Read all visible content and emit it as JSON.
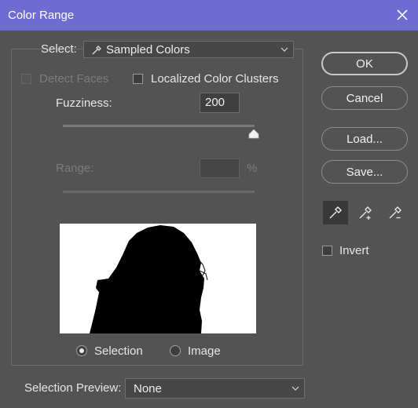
{
  "window": {
    "title": "Color Range"
  },
  "select": {
    "label": "Select:",
    "value": "Sampled Colors"
  },
  "detect_faces": {
    "label": "Detect Faces",
    "checked": false,
    "enabled": false
  },
  "localized_clusters": {
    "label": "Localized Color Clusters",
    "checked": false
  },
  "fuzziness": {
    "label": "Fuzziness:",
    "value": "200"
  },
  "range": {
    "label": "Range:",
    "value": "",
    "unit": "%"
  },
  "preview_mode": {
    "selection_label": "Selection",
    "image_label": "Image",
    "selected": "Selection"
  },
  "selection_preview": {
    "label": "Selection Preview:",
    "value": "None"
  },
  "buttons": {
    "ok": "OK",
    "cancel": "Cancel",
    "load": "Load...",
    "save": "Save..."
  },
  "tools": [
    "eyedropper-icon",
    "eyedropper-plus-icon",
    "eyedropper-minus-icon"
  ],
  "invert": {
    "label": "Invert",
    "checked": false
  },
  "colors": {
    "titlebar": "#6e6bd1",
    "background": "#535353"
  }
}
